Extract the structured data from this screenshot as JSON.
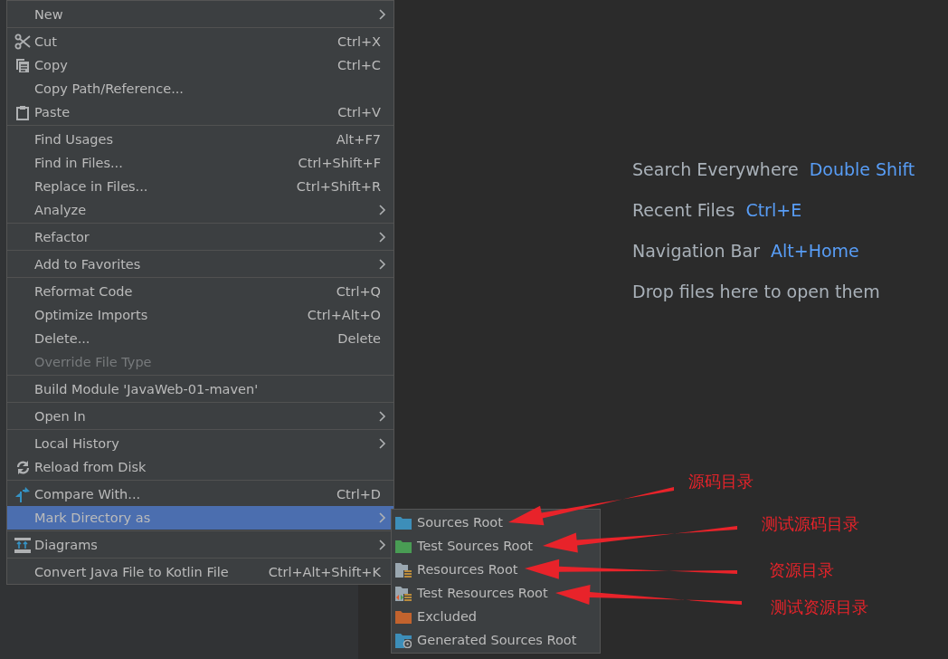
{
  "context_menu": {
    "groups": [
      {
        "items": [
          {
            "label": "New",
            "submenu": true,
            "disabled": false,
            "selected": false
          }
        ]
      },
      {
        "items": [
          {
            "label": "Cut",
            "shortcut": "Ctrl+X",
            "submenu": false,
            "disabled": false,
            "selected": false
          },
          {
            "label": "Copy",
            "shortcut": "Ctrl+C",
            "submenu": false,
            "disabled": false,
            "selected": false
          },
          {
            "label": "Copy Path/Reference...",
            "submenu": false,
            "disabled": false,
            "selected": false
          },
          {
            "label": "Paste",
            "shortcut": "Ctrl+V",
            "submenu": false,
            "disabled": false,
            "selected": false
          }
        ]
      },
      {
        "items": [
          {
            "label": "Find Usages",
            "shortcut": "Alt+F7",
            "submenu": false,
            "disabled": false,
            "selected": false
          },
          {
            "label": "Find in Files...",
            "shortcut": "Ctrl+Shift+F",
            "submenu": false,
            "disabled": false,
            "selected": false
          },
          {
            "label": "Replace in Files...",
            "shortcut": "Ctrl+Shift+R",
            "submenu": false,
            "disabled": false,
            "selected": false
          },
          {
            "label": "Analyze",
            "submenu": true,
            "disabled": false,
            "selected": false
          }
        ]
      },
      {
        "items": [
          {
            "label": "Refactor",
            "submenu": true,
            "disabled": false,
            "selected": false
          }
        ]
      },
      {
        "items": [
          {
            "label": "Add to Favorites",
            "submenu": true,
            "disabled": false,
            "selected": false
          }
        ]
      },
      {
        "items": [
          {
            "label": "Reformat Code",
            "shortcut": "Ctrl+Q",
            "submenu": false,
            "disabled": false,
            "selected": false
          },
          {
            "label": "Optimize Imports",
            "shortcut": "Ctrl+Alt+O",
            "submenu": false,
            "disabled": false,
            "selected": false
          },
          {
            "label": "Delete...",
            "shortcut": "Delete",
            "submenu": false,
            "disabled": false,
            "selected": false
          },
          {
            "label": "Override File Type",
            "submenu": false,
            "disabled": true,
            "selected": false
          }
        ]
      },
      {
        "items": [
          {
            "label": "Build Module 'JavaWeb-01-maven'",
            "submenu": false,
            "disabled": false,
            "selected": false
          }
        ]
      },
      {
        "items": [
          {
            "label": "Open In",
            "submenu": true,
            "disabled": false,
            "selected": false
          }
        ]
      },
      {
        "items": [
          {
            "label": "Local History",
            "submenu": true,
            "disabled": false,
            "selected": false
          },
          {
            "label": "Reload from Disk",
            "submenu": false,
            "disabled": false,
            "selected": false
          }
        ]
      },
      {
        "items": [
          {
            "label": "Compare With...",
            "shortcut": "Ctrl+D",
            "submenu": false,
            "disabled": false,
            "selected": false
          },
          {
            "label": "Mark Directory as",
            "submenu": true,
            "disabled": false,
            "selected": true
          }
        ]
      },
      {
        "items": [
          {
            "label": "Diagrams",
            "submenu": true,
            "disabled": false,
            "selected": false
          }
        ]
      },
      {
        "items": [
          {
            "label": "Convert Java File to Kotlin File",
            "shortcut": "Ctrl+Alt+Shift+K",
            "submenu": false,
            "disabled": false,
            "selected": false
          }
        ]
      }
    ]
  },
  "submenu": {
    "items": [
      {
        "label": "Sources Root",
        "kind": "plain",
        "color": "#3d8eb9"
      },
      {
        "label": "Test Sources Root",
        "kind": "plain",
        "color": "#499c54"
      },
      {
        "label": "Resources Root",
        "kind": "resources",
        "color": "#9aa7b0"
      },
      {
        "label": "Test Resources Root",
        "kind": "test_resources",
        "color": "#9aa7b0"
      },
      {
        "label": "Excluded",
        "kind": "plain",
        "color": "#c2632e"
      },
      {
        "label": "Generated Sources Root",
        "kind": "generated",
        "color": "#3d8eb9"
      }
    ]
  },
  "welcome_hints": [
    {
      "label": "Search Everywhere",
      "shortcut": "Double Shift"
    },
    {
      "label": "Recent Files",
      "shortcut": "Ctrl+E"
    },
    {
      "label": "Navigation Bar",
      "shortcut": "Alt+Home"
    },
    {
      "label": "Drop files here to open them"
    }
  ],
  "annotations": [
    "源码目录",
    "测试源码目录",
    "资源目录",
    "测试资源目录"
  ]
}
